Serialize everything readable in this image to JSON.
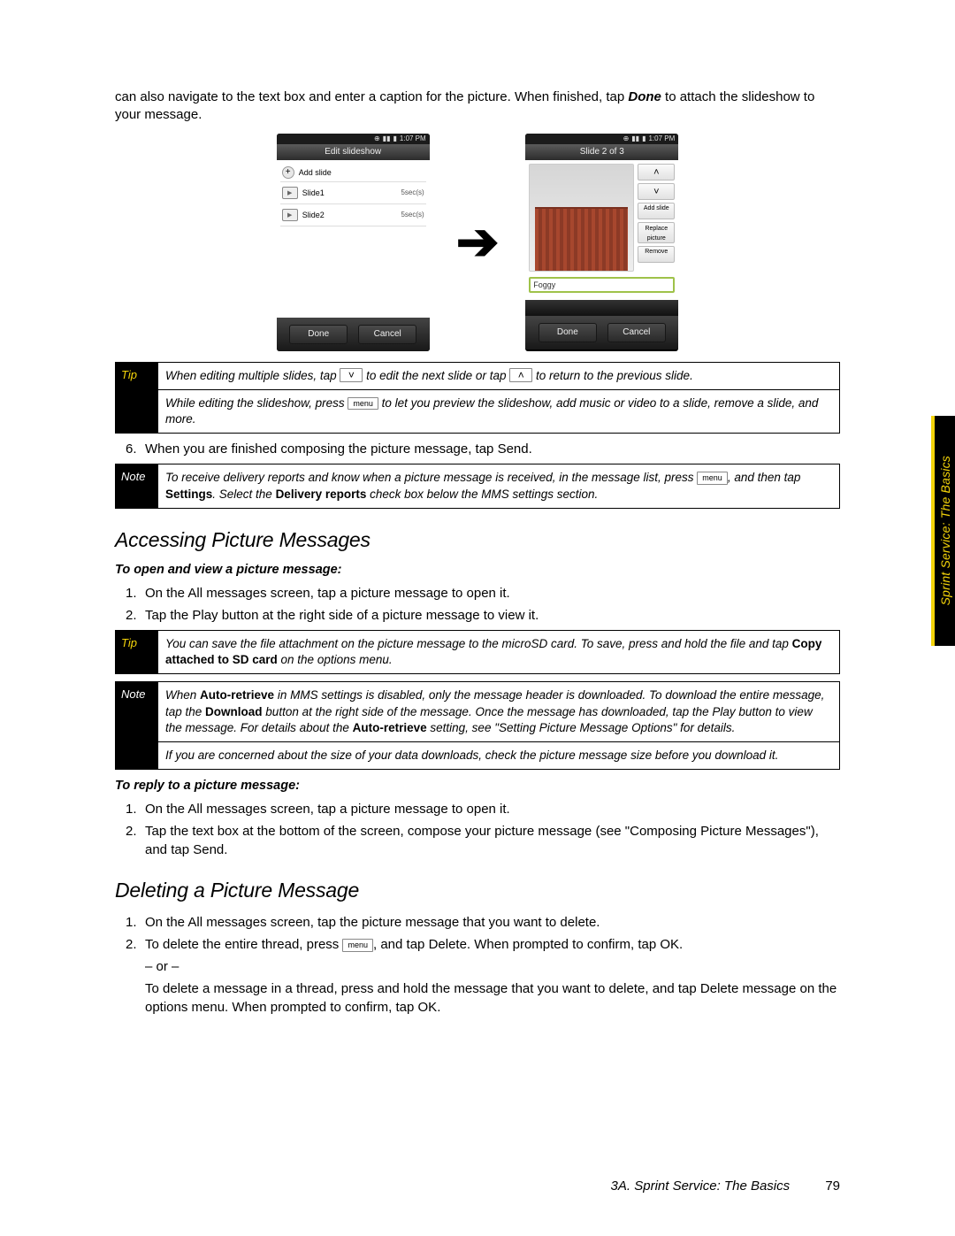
{
  "side_tab": "Sprint Service: The Basics",
  "intro": {
    "pre": "can also navigate to the text box and enter a caption for the picture. When finished, tap ",
    "done": "Done",
    "post": " to attach the slideshow to your message."
  },
  "phone1": {
    "time": "1:07 PM",
    "title": "Edit slideshow",
    "add": "Add slide",
    "slides": [
      {
        "name": "Slide1",
        "dur": "5sec(s)"
      },
      {
        "name": "Slide2",
        "dur": "5sec(s)"
      }
    ],
    "done": "Done",
    "cancel": "Cancel"
  },
  "phone2": {
    "time": "1:07 PM",
    "title": "Slide 2 of 3",
    "btns": {
      "up": "˄",
      "down": "˅",
      "add": "Add slide",
      "replace": "Replace picture",
      "remove": "Remove"
    },
    "caption": "Foggy",
    "done": "Done",
    "cancel": "Cancel"
  },
  "tipbox1": {
    "label": "Tip",
    "r1_a": "When editing multiple slides, tap ",
    "r1_b": " to edit the next slide or tap ",
    "r1_c": " to return to the previous slide.",
    "r2_a": "While editing the slideshow, press ",
    "r2_b": " to let you preview the slideshow, add music or video to a slide, remove a slide, and more.",
    "menu": "menu"
  },
  "step6": {
    "n": "6.",
    "a": "When you are finished composing the picture message, tap ",
    "b": "Send",
    "c": "."
  },
  "notebox1": {
    "label": "Note",
    "a": "To receive delivery reports and know when a picture message is received, in the message list, press ",
    "menu": "menu",
    "b": ", and then tap ",
    "settings": "Settings",
    "c": ". Select the ",
    "dr": "Delivery reports",
    "d": " check box below the MMS settings section."
  },
  "sect1": "Accessing Picture Messages",
  "sub1": "To open and view a picture message:",
  "openSteps": [
    "On the All messages screen, tap a picture message to open it.",
    "Tap the Play button at the right side of a picture message to view it."
  ],
  "tipbox2": {
    "label": "Tip",
    "a": "You can save the file attachment on the picture message to the microSD card. To save, press and hold the file and tap ",
    "b": "Copy attached to SD card",
    "c": " on the options menu."
  },
  "notebox2": {
    "label": "Note",
    "r1_a": "When ",
    "r1_ar": "Auto-retrieve",
    "r1_b": " in MMS settings is disabled, only the message header is downloaded. To download the entire message, tap the ",
    "r1_dl": "Download",
    "r1_c": " button at the right side of the message. Once the message has downloaded, tap the Play button to view the message. For details about the ",
    "r1_ar2": "Auto-retrieve",
    "r1_d": " setting, see \"Setting Picture Message Options\" for details.",
    "r2": "If you are concerned about the size of your data downloads, check the picture message size before you download it."
  },
  "sub2": "To reply to a picture message:",
  "replySteps": {
    "s1": "On the All messages screen, tap a picture message to open it.",
    "s2_a": "Tap the text box at the bottom of the screen, compose your picture message (see \"Composing Picture Messages\"), and tap ",
    "s2_b": "Send",
    "s2_c": "."
  },
  "sect2": "Deleting a Picture Message",
  "delSteps": {
    "s1": "On the All messages screen, tap the picture message that you want to delete.",
    "s2_a": "To delete the entire thread, press ",
    "menu": "menu",
    "s2_b": ", and tap ",
    "del": "Delete",
    "s2_c": ". When prompted to confirm, tap ",
    "ok": "OK",
    "s2_d": ".",
    "or": "– or –",
    "s3_a": "To delete a message in a thread, press and hold the message that you want to delete, and tap ",
    "dm": "Delete message",
    "s3_b": " on the options menu. When prompted to confirm, tap ",
    "s3_c": "."
  },
  "footer": {
    "section": "3A. Sprint Service: The Basics",
    "page": "79"
  }
}
